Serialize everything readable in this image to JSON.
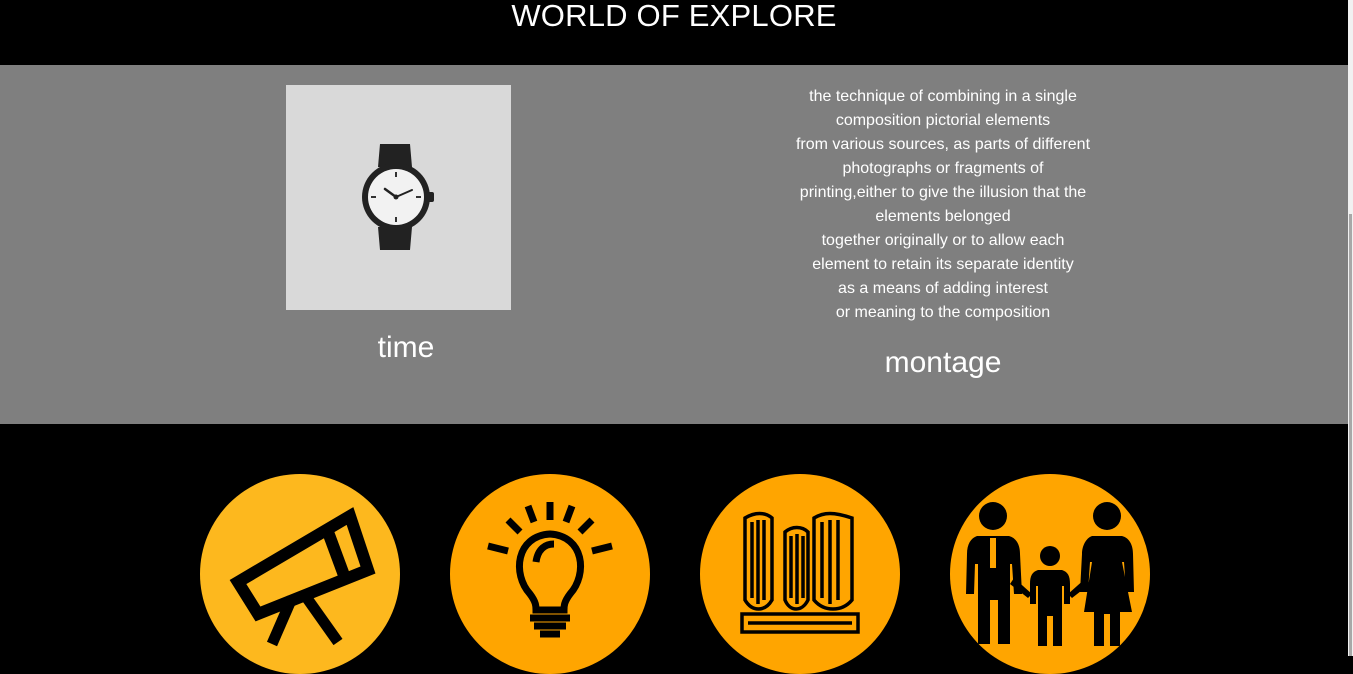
{
  "header": {
    "title": "WORLD OF EXPLORE"
  },
  "features": {
    "time": {
      "caption": "time",
      "icon": "wristwatch-icon"
    },
    "montage": {
      "caption": "montage",
      "description_lines": [
        "the technique of combining in a single",
        "composition pictorial elements",
        "from various sources, as parts of different",
        "photographs or fragments of",
        "printing,either to give the illusion that the",
        "elements belonged",
        "together originally or to allow each",
        "element to retain its separate identity",
        "as a means of adding interest",
        "or meaning to the composition"
      ]
    }
  },
  "icon_row": [
    {
      "icon": "telescope-icon",
      "color": "#fdb81e"
    },
    {
      "icon": "lightbulb-icon",
      "color": "#ffa500"
    },
    {
      "icon": "books-icon",
      "color": "#ffa500"
    },
    {
      "icon": "family-icon",
      "color": "#ffa500"
    }
  ],
  "colors": {
    "background": "#000000",
    "band": "#7f7f7f",
    "tile": "#d9d9d9",
    "accent_orange": "#ffa500",
    "accent_yellow": "#fdb81e"
  }
}
